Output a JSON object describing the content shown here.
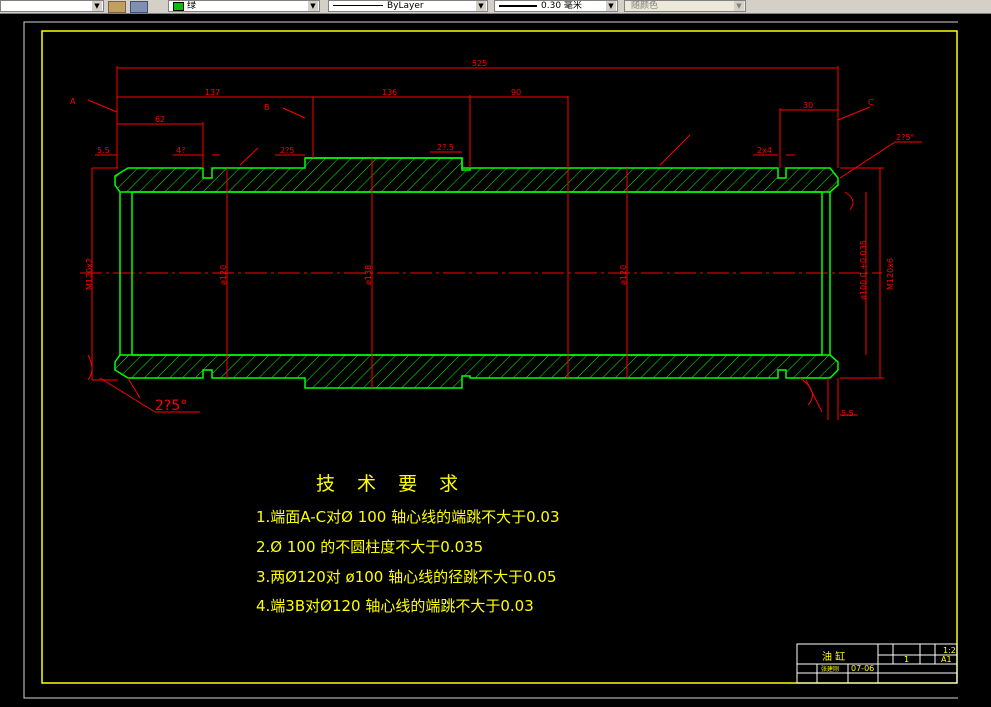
{
  "toolbar": {
    "color_value": "绿",
    "linetype_value": "ByLayer",
    "lineweight_value": "0.30 毫米",
    "plotstyle_value": "随颜色"
  },
  "drawing": {
    "dimensions": {
      "overall": "525",
      "d137": "137",
      "d136": "136",
      "d90": "90",
      "d30": "30",
      "d62": "62",
      "d5_5_left": "5.5",
      "d4_2": "4?",
      "d2_25_a": "2?5",
      "d2_75": "2?.5",
      "d2x4": "2x4",
      "chamfer_top": "2?5°",
      "chamfer_bottom": "2?5°",
      "d5_5_right": "5.5",
      "thread_left": "M120x2",
      "thread_right": "M120x6",
      "dia120_left": "ø120",
      "dia138": "ø138",
      "dia120_right": "ø120",
      "dia100": "ø100  0 +0.035",
      "label_a": "A",
      "label_b": "B",
      "label_c": "C"
    },
    "requirements": {
      "title": "技 术 要 求",
      "items": [
        "1.端面A-C对Ø 100  轴心线的端跳不大于0.03",
        "2.Ø 100  的不圆柱度不大于0.035",
        "3.两Ø120对 ø100  轴心线的径跳不大于0.05",
        "4.端3B对Ø120 轴心线的端跳不大于0.03"
      ]
    },
    "title_block": {
      "part_name": "油 缸",
      "scale": "1:2",
      "sheet_size": "A1",
      "quantity": "1",
      "code": "07-06",
      "designer": "张建刚"
    }
  },
  "colors": {
    "outline": "#00ff00",
    "centerline": "#ff0000",
    "dimension": "#ff0000",
    "hatch": "#00ff00",
    "text": "#ffff00",
    "border": "#ffff00"
  }
}
